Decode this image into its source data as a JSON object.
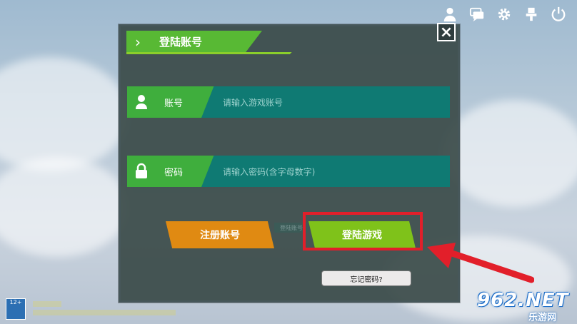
{
  "top_icons": [
    "profile-icon",
    "chat-icon",
    "settings-icon",
    "upload-icon",
    "power-icon"
  ],
  "title": "登陆账号",
  "close_label": "×",
  "account": {
    "label": "账号",
    "placeholder": "请输入游戏账号"
  },
  "password": {
    "label": "密码",
    "placeholder": "请输入密码(含字母数字)"
  },
  "buttons": {
    "register": "注册账号",
    "small_tab": "登陆账号",
    "login": "登陆游戏",
    "forgot": "忘记密码?"
  },
  "age_badge": "12+",
  "watermark": {
    "brand": "962.NET",
    "sub": "乐游网"
  },
  "colors": {
    "highlight": "#e21f2a",
    "login_green": "#7fc21a",
    "register_orange": "#e08a12",
    "field_teal": "#0f7a73",
    "label_green": "#3fae3d"
  }
}
